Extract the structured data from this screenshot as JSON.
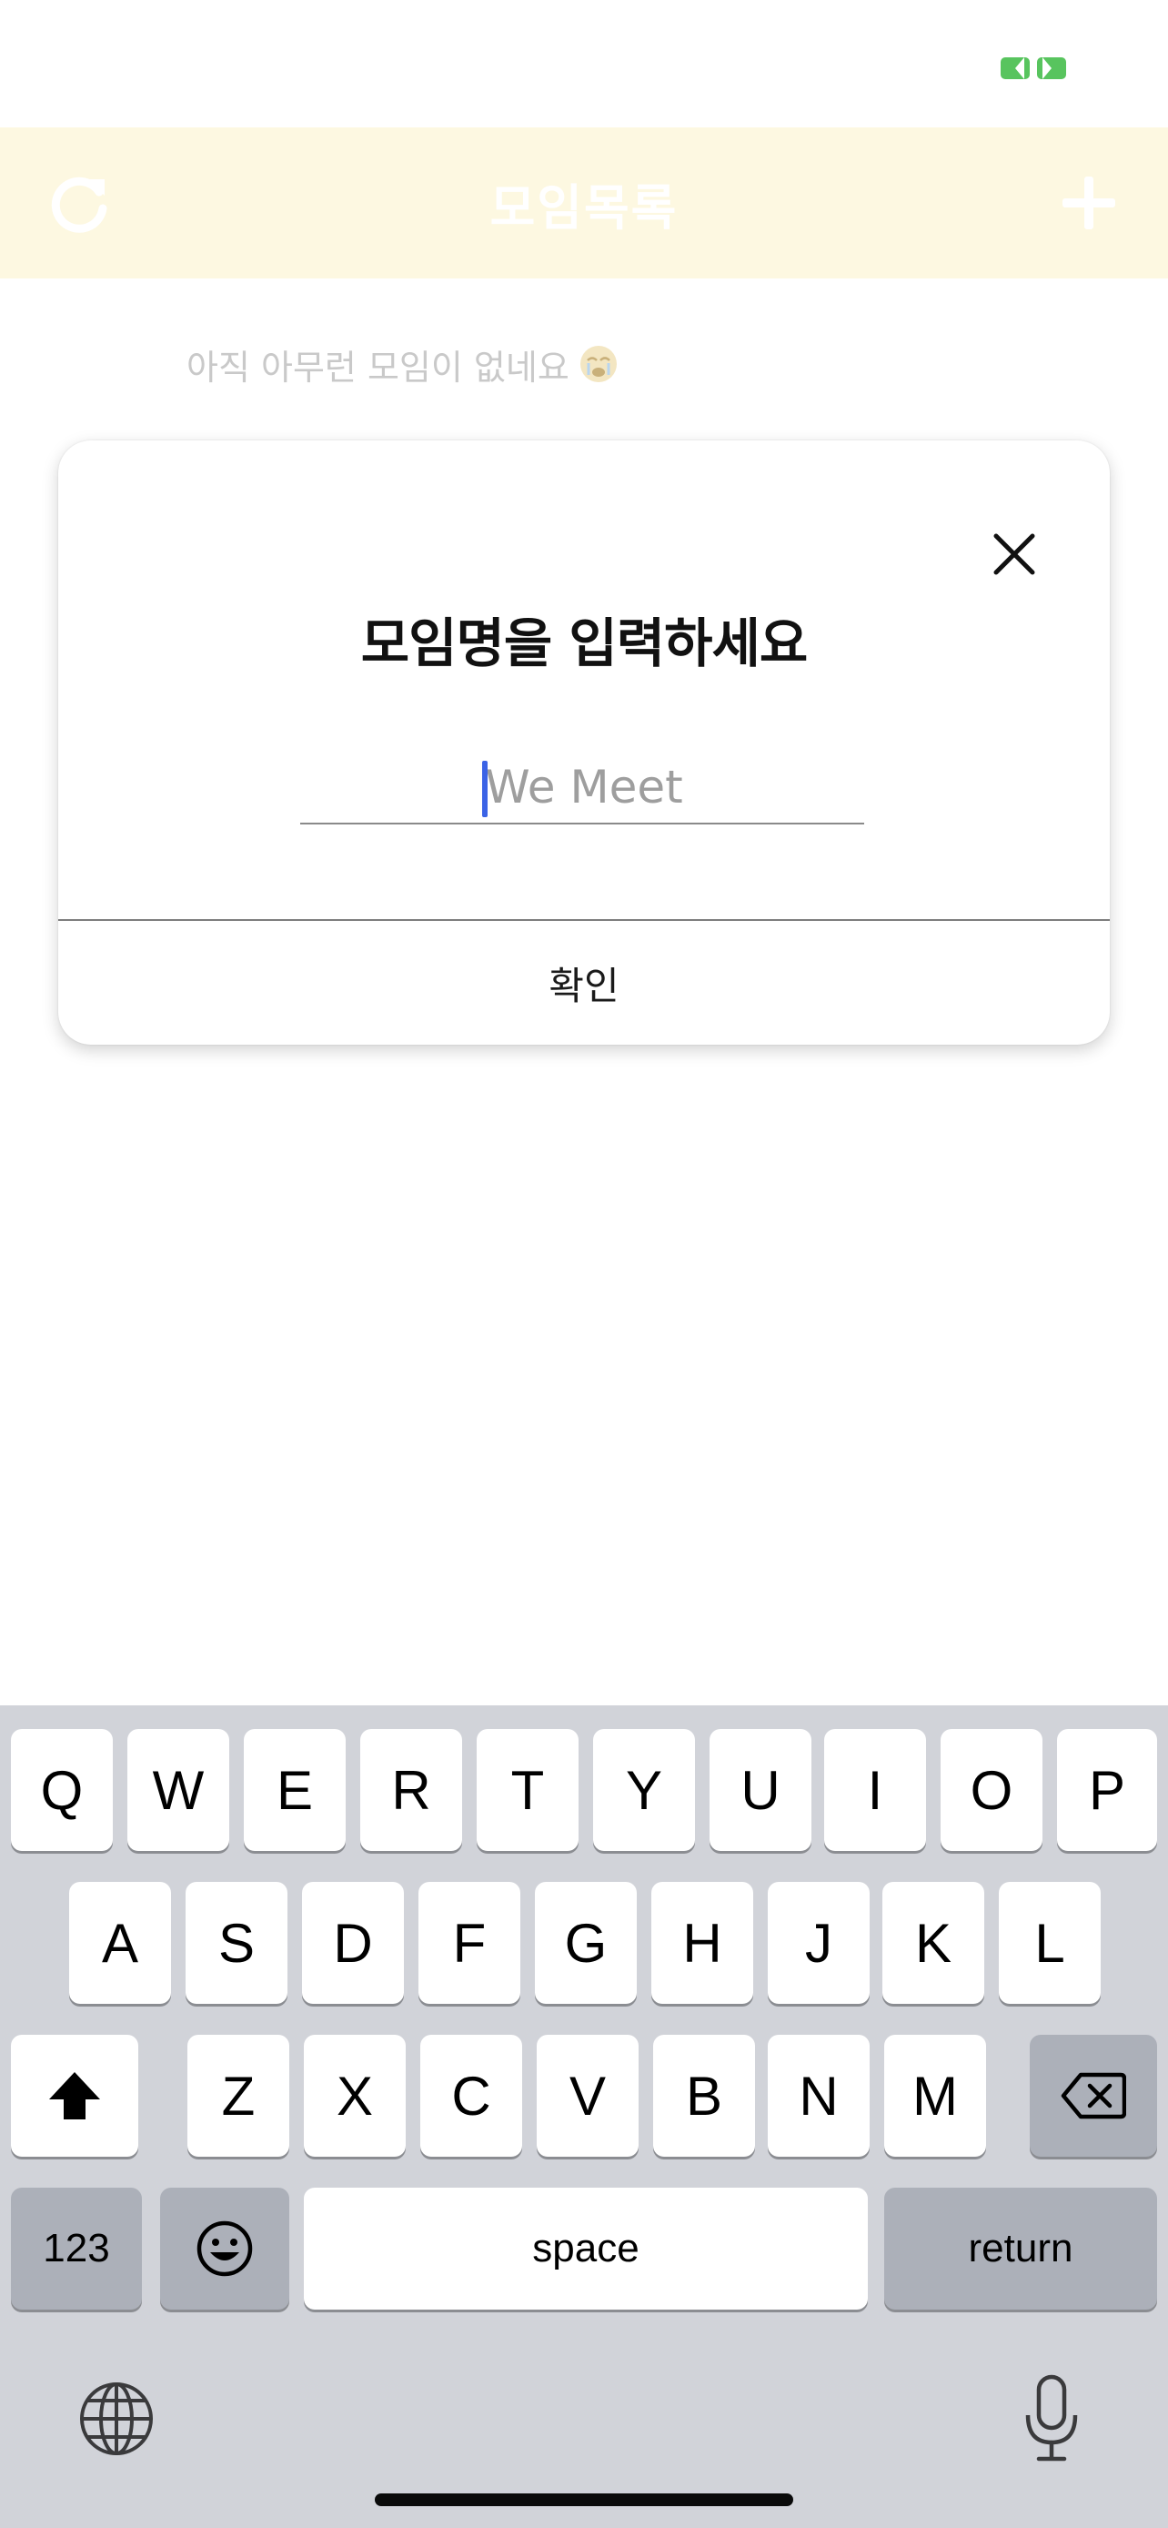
{
  "colors": {
    "header_bg": "#fdf8e1",
    "header_text": "#ffffff",
    "battery": "#58c45e",
    "cursor": "#3b63e6",
    "keyboard_bg": "#d1d3d9",
    "key_dark": "#acb0b9"
  },
  "status_bar": {
    "indicator_icon": "battery-indicator-icon"
  },
  "header": {
    "title": "모임목록",
    "left_icon": "refresh-icon",
    "right_icon": "plus-icon"
  },
  "empty_state": {
    "message": "아직 아무런 모임이 없네요",
    "emoji_icon": "sad-face-emoji-icon"
  },
  "dialog": {
    "title": "모임명을 입력하세요",
    "input": {
      "placeholder": "We Meet",
      "value": ""
    },
    "confirm_label": "확인",
    "close_icon": "close-icon"
  },
  "keyboard": {
    "row1": [
      "Q",
      "W",
      "E",
      "R",
      "T",
      "Y",
      "U",
      "I",
      "O",
      "P"
    ],
    "row2": [
      "A",
      "S",
      "D",
      "F",
      "G",
      "H",
      "J",
      "K",
      "L"
    ],
    "row3": [
      "Z",
      "X",
      "C",
      "V",
      "B",
      "N",
      "M"
    ],
    "numbers_label": "123",
    "space_label": "space",
    "return_label": "return"
  }
}
